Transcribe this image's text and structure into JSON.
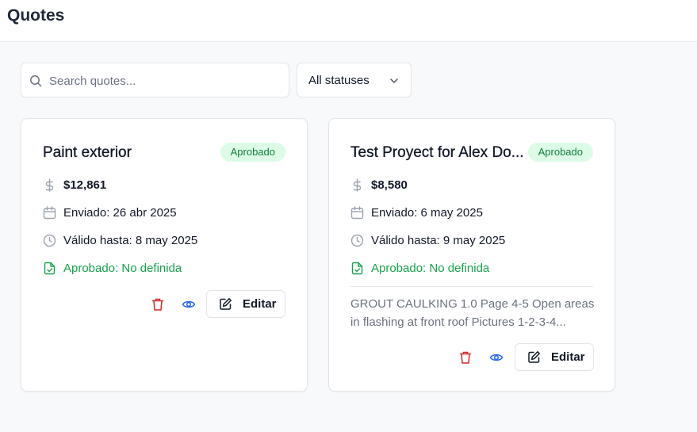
{
  "header": {
    "title": "Quotes"
  },
  "filters": {
    "search_placeholder": "Search quotes...",
    "search_value": "",
    "status_selected": "All statuses"
  },
  "colors": {
    "badge_bg": "#dcfce7",
    "badge_text": "#15803d",
    "delete": "#dc2626",
    "view": "#2563eb",
    "approved_text": "#16a34a"
  },
  "quotes": [
    {
      "title": "Paint exterior",
      "status": "Aprobado",
      "amount": "$12,861",
      "sent": "Enviado: 26 abr 2025",
      "valid": "Válido hasta: 8 may 2025",
      "approved": "Aprobado: No definida",
      "description": "",
      "edit_label": "Editar"
    },
    {
      "title": "Test Proyect for Alex Do...",
      "status": "Aprobado",
      "amount": "$8,580",
      "sent": "Enviado: 6 may 2025",
      "valid": "Válido hasta: 9 may 2025",
      "approved": "Aprobado: No definida",
      "description": "GROUT CAULKING 1.0 Page 4-5 Open areas in flashing at front roof Pictures 1-2-3-4...",
      "edit_label": "Editar"
    }
  ]
}
